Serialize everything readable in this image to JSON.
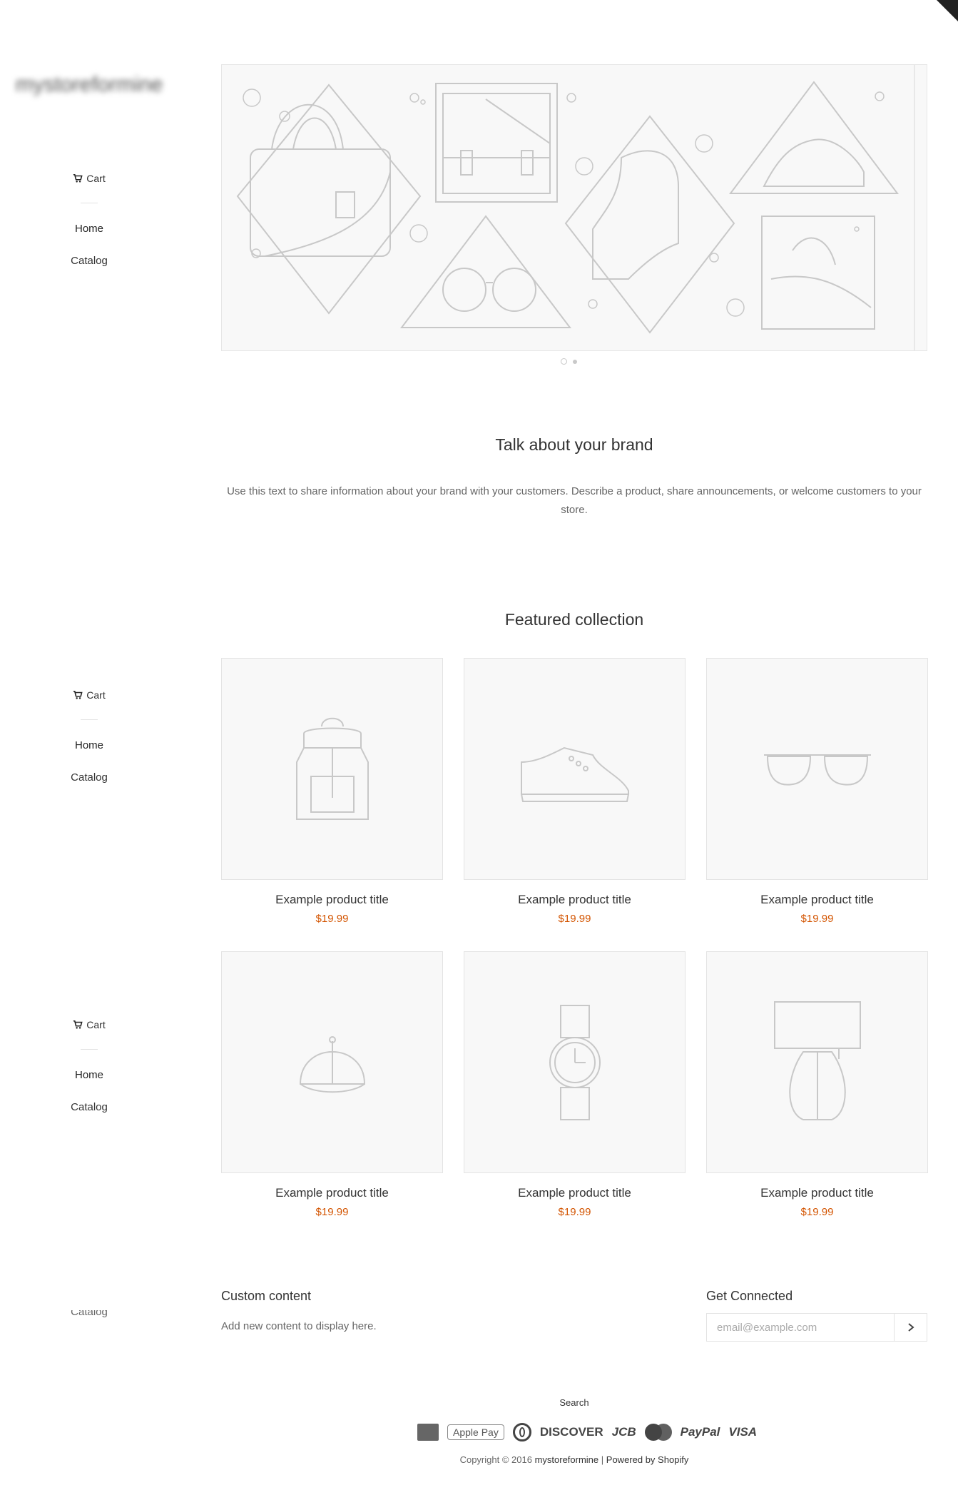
{
  "store": {
    "name": "mystoreformine"
  },
  "sidebar": {
    "cart_label": "Cart",
    "nav": [
      {
        "label": "Home"
      },
      {
        "label": "Catalog"
      }
    ]
  },
  "hero": {
    "slides": 2,
    "active_slide": 1,
    "illustration_items": [
      "handbag-icon",
      "messenger-bag-icon",
      "boot-icon",
      "sneaker-icon",
      "glasses-icon",
      "hat-icon"
    ]
  },
  "intro": {
    "heading": "Talk about your brand",
    "text": "Use this text to share information about your brand with your customers. Describe a product, share announcements, or welcome customers to your store."
  },
  "featured": {
    "heading": "Featured collection",
    "products": [
      {
        "icon": "backpack-icon",
        "title": "Example product title",
        "price": "$19.99"
      },
      {
        "icon": "sneaker-icon",
        "title": "Example product title",
        "price": "$19.99"
      },
      {
        "icon": "sunglasses-icon",
        "title": "Example product title",
        "price": "$19.99"
      },
      {
        "icon": "cap-icon",
        "title": "Example product title",
        "price": "$19.99"
      },
      {
        "icon": "watch-icon",
        "title": "Example product title",
        "price": "$19.99"
      },
      {
        "icon": "lamp-icon",
        "title": "Example product title",
        "price": "$19.99"
      }
    ]
  },
  "footer": {
    "custom_heading": "Custom content",
    "custom_text": "Add new content to display here.",
    "connect_heading": "Get Connected",
    "email_placeholder": "email@example.com",
    "search_link": "Search",
    "payments": [
      "Apple Pay",
      "DISCOVER",
      "JCB",
      "PayPal",
      "VISA"
    ],
    "copyright_prefix": "Copyright © 2016",
    "copyright_store": "mystoreformine",
    "separator": "|",
    "powered_by": "Powered by Shopify"
  },
  "colors": {
    "price": "#d35400",
    "text": "#333333",
    "muted": "#666666",
    "line_art": "#c8c8c8"
  }
}
